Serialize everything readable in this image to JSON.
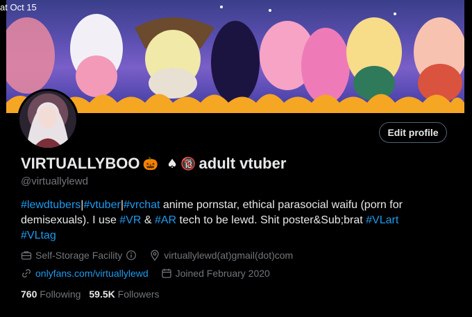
{
  "banner": {
    "date_tag": "at Oct 15"
  },
  "profile": {
    "edit_label": "Edit profile",
    "display_name": "VIRTUALLYBOO",
    "emoji_pumpkin": "🎃",
    "emoji_spade": "♠",
    "emoji_18": "🔞",
    "display_suffix": "adult vtuber",
    "handle": "@virtuallylewd"
  },
  "bio": {
    "tag1": "#lewdtubers",
    "sep1": "|",
    "tag2": "#vtuber",
    "sep2": "|",
    "tag3": "#vrchat",
    "text1": " anime pornstar, ethical parasocial waifu (porn for demisexuals). I use ",
    "tag4": "#VR",
    "text2": " & ",
    "tag5": "#AR",
    "text3": " tech to be lewd. Shit poster&Sub;brat ",
    "tag6": "#VLart",
    "tag7": "#VLtag"
  },
  "meta": {
    "category": "Self-Storage Facility",
    "location": "virtuallylewd(at)gmail(dot)com",
    "website": "onlyfans.com/virtuallylewd",
    "joined": "Joined February 2020"
  },
  "stats": {
    "following_count": "760",
    "following_label": "Following",
    "followers_count": "59.5K",
    "followers_label": "Followers"
  },
  "colors": {
    "accent": "#1d9bf0",
    "muted": "#71767b"
  }
}
